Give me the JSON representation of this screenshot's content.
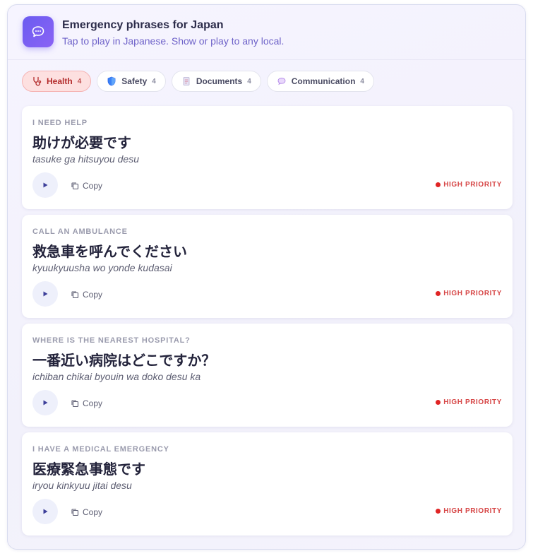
{
  "header": {
    "title": "Emergency phrases for Japan",
    "subtitle": "Tap to play in Japanese. Show or play to any local.",
    "icon": "chat-bubble-icon",
    "accent": "#7b5cf2"
  },
  "tabs": [
    {
      "label": "Health",
      "count": "4",
      "icon": "stethoscope-icon",
      "active": true
    },
    {
      "label": "Safety",
      "count": "4",
      "icon": "shield-icon",
      "active": false
    },
    {
      "label": "Documents",
      "count": "4",
      "icon": "document-icon",
      "active": false
    },
    {
      "label": "Communication",
      "count": "4",
      "icon": "speech-bubble-icon",
      "active": false
    }
  ],
  "phrases": [
    {
      "label": "I NEED HELP",
      "japanese": "助けが必要です",
      "romaji": "tasuke ga hitsuyou desu",
      "copy_label": "Copy",
      "priority": "HIGH PRIORITY"
    },
    {
      "label": "CALL AN AMBULANCE",
      "japanese": "救急車を呼んでください",
      "romaji": "kyuukyuusha wo yonde kudasai",
      "copy_label": "Copy",
      "priority": "HIGH PRIORITY"
    },
    {
      "label": "WHERE IS THE NEAREST HOSPITAL?",
      "japanese": "一番近い病院はどこですか？",
      "romaji": "ichiban chikai byouin wa doko desu ka",
      "copy_label": "Copy",
      "priority": "HIGH PRIORITY"
    },
    {
      "label": "I HAVE A MEDICAL EMERGENCY",
      "japanese": "医療緊急事態です",
      "romaji": "iryou kinkyuu jitai desu",
      "copy_label": "Copy",
      "priority": "HIGH PRIORITY"
    }
  ],
  "colors": {
    "priority": "#e02424",
    "active_tab_bg": "#fde0e0",
    "play_icon": "#3d3f9a"
  }
}
